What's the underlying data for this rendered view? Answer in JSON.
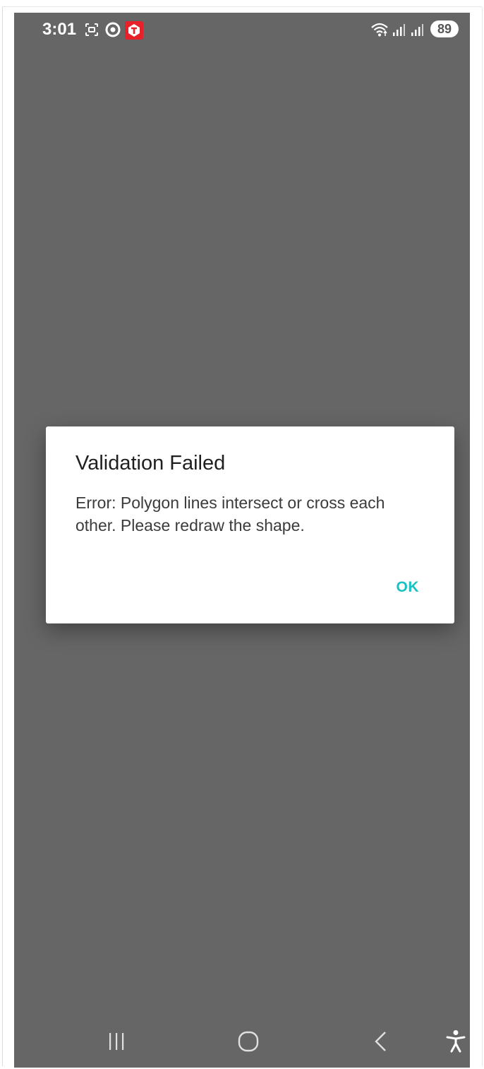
{
  "status_bar": {
    "time": "3:01",
    "icons_left": [
      "screenshot-icon",
      "target-icon",
      "tata-app-icon"
    ],
    "icons_right": [
      "wifi-icon",
      "signal-icon-sim1",
      "signal-icon-sim2"
    ],
    "battery_level": "89"
  },
  "dialog": {
    "title": "Validation Failed",
    "message": "Error: Polygon lines intersect or cross each other. Please redraw the shape.",
    "ok_label": "OK"
  },
  "nav_bar": {
    "buttons": [
      "recents-icon",
      "home-icon",
      "back-icon",
      "accessibility-icon"
    ]
  },
  "colors": {
    "scrim": "#666666",
    "accent": "#19C2C2",
    "dialog_bg": "#FFFFFF",
    "app_badge_red": "#E8202A"
  }
}
